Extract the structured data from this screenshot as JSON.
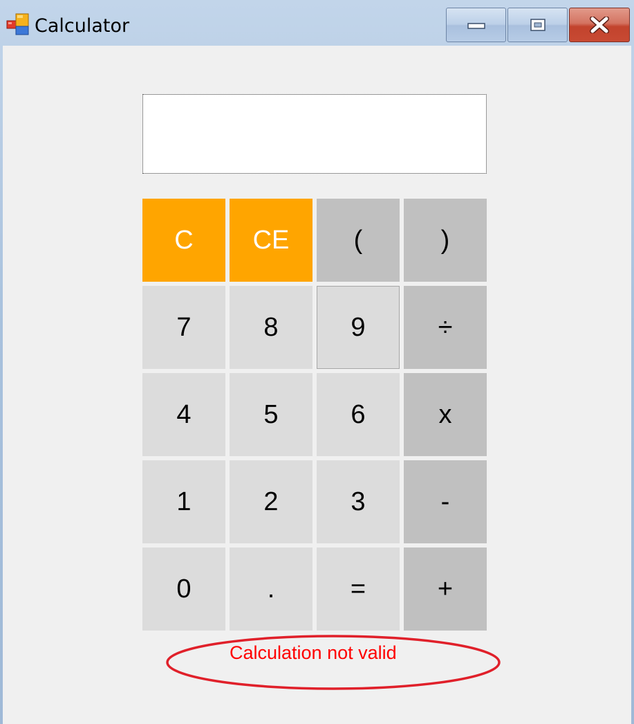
{
  "window": {
    "title": "Calculator",
    "icon": "calculator-app-icon",
    "controls": {
      "minimize_icon": "minimize-icon",
      "maximize_icon": "maximize-icon",
      "close_icon": "close-icon"
    }
  },
  "display": {
    "value": ""
  },
  "keypad": {
    "rows": [
      [
        {
          "label": "C",
          "style": "orange"
        },
        {
          "label": "CE",
          "style": "orange"
        },
        {
          "label": "(",
          "style": "op"
        },
        {
          "label": ")",
          "style": "op"
        }
      ],
      [
        {
          "label": "7",
          "style": "digit"
        },
        {
          "label": "8",
          "style": "digit"
        },
        {
          "label": "9",
          "style": "digit"
        },
        {
          "label": "÷",
          "style": "op"
        }
      ],
      [
        {
          "label": "4",
          "style": "digit"
        },
        {
          "label": "5",
          "style": "digit"
        },
        {
          "label": "6",
          "style": "digit"
        },
        {
          "label": "x",
          "style": "op"
        }
      ],
      [
        {
          "label": "1",
          "style": "digit"
        },
        {
          "label": "2",
          "style": "digit"
        },
        {
          "label": "3",
          "style": "digit"
        },
        {
          "label": "-",
          "style": "op"
        }
      ],
      [
        {
          "label": "0",
          "style": "digit"
        },
        {
          "label": ".",
          "style": "digit"
        },
        {
          "label": "=",
          "style": "digit"
        },
        {
          "label": "+",
          "style": "op"
        }
      ]
    ],
    "focused_key": "9"
  },
  "error": {
    "message": "Calculation not valid"
  },
  "colors": {
    "clear_keys": "#ffa500",
    "operator_keys": "#c0c0c0",
    "digit_keys": "#dcdcdc",
    "error_text": "#ff0000",
    "error_highlight": "#e0202a"
  }
}
